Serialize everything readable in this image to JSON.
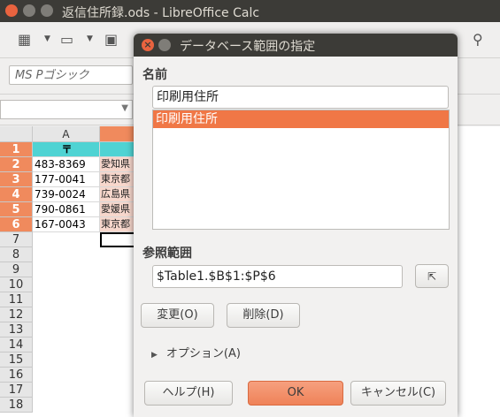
{
  "window": {
    "title": "返信住所録.ods - LibreOffice Calc"
  },
  "toolbar": {
    "font_name": "MS Pゴシック"
  },
  "sheet": {
    "column_headers": [
      "A"
    ],
    "rows": [
      "1",
      "2",
      "3",
      "4",
      "5",
      "6",
      "7",
      "8",
      "9",
      "10",
      "11",
      "12",
      "13",
      "14",
      "15",
      "16",
      "17",
      "18"
    ],
    "col_a": [
      "〒",
      "483-8369",
      "177-0041",
      "739-0024",
      "790-0861",
      "167-0043"
    ],
    "col_b": [
      "",
      "愛知県",
      "東京都",
      "広島県",
      "愛媛県",
      "東京都"
    ]
  },
  "dialog": {
    "title": "データベース範囲の指定",
    "name_label": "名前",
    "name_value": "印刷用住所",
    "list_items": [
      "印刷用住所"
    ],
    "range_label": "参照範囲",
    "range_value": "$Table1.$B$1:$P$6",
    "modify_button": "変更(O)",
    "delete_button": "削除(D)",
    "options_label": "オプション(A)",
    "help_button": "ヘルプ(H)",
    "ok_button": "OK",
    "cancel_button": "キャンセル(C)"
  },
  "colors": {
    "accent": "#f07746",
    "header_cyan": "#4fd3d3",
    "title_bar": "#3c3b37"
  }
}
